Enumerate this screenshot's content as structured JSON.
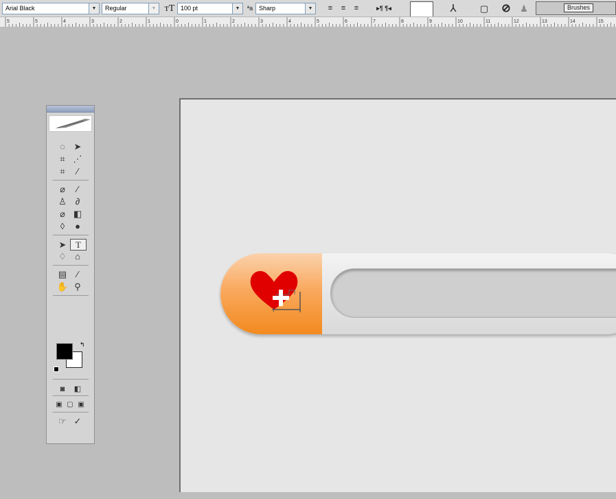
{
  "options_bar": {
    "font_family": "Arial Black",
    "font_style": "Regular",
    "font_size": "100 pt",
    "anti_alias": "Sharp",
    "palette_button": "Brushes"
  },
  "ruler": {
    "numbers": [
      "5",
      "5",
      "4",
      "3",
      "2",
      "1",
      "0",
      "1",
      "2",
      "3",
      "4",
      "5",
      "6",
      "7",
      "8",
      "9",
      "10",
      "11",
      "12",
      "13",
      "14",
      "15"
    ]
  },
  "canvas": {
    "accent_orange": "#f28a1f",
    "heart_color": "#e00000"
  }
}
